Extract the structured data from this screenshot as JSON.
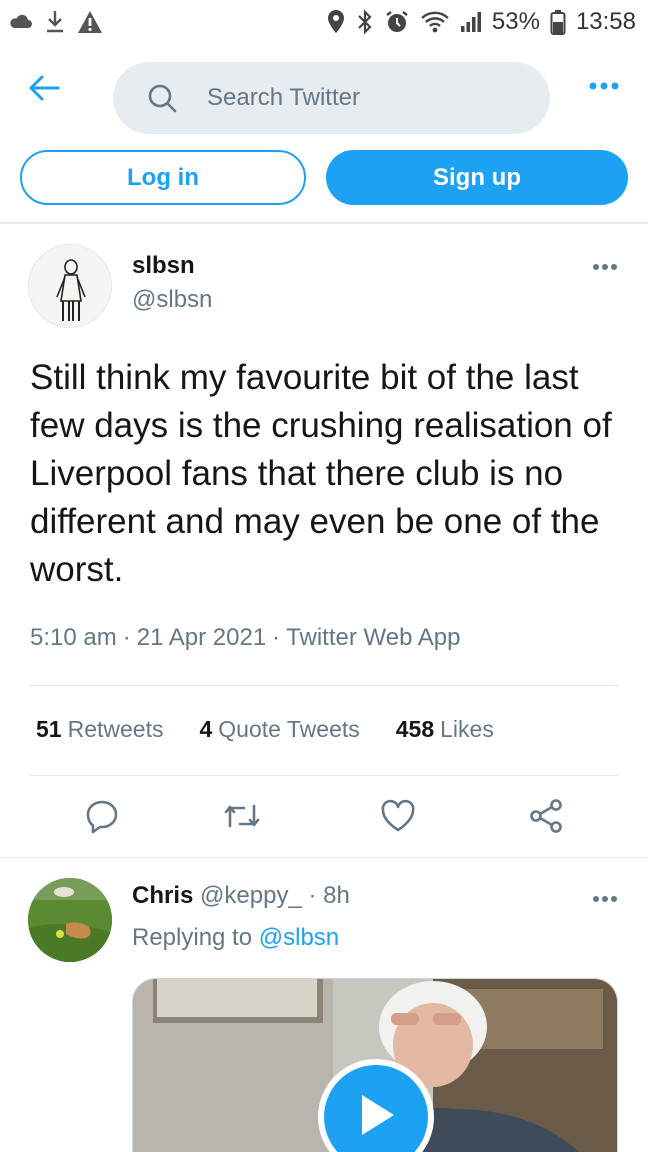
{
  "status_bar": {
    "battery": "53%",
    "time": "13:58"
  },
  "nav": {
    "back_icon": "arrow-left-icon",
    "search_placeholder": "Search Twitter",
    "more_icon": "more-dots-icon"
  },
  "auth": {
    "login_label": "Log in",
    "signup_label": "Sign up"
  },
  "tweet": {
    "author_name": "slbsn",
    "author_handle": "@slbsn",
    "text": "Still think my favourite bit of the last few days is the crushing realisation of Liverpool fans that there club is no different and may even be one of the worst.",
    "time": "5:10 am",
    "date": "21 Apr 2021",
    "source": "Twitter Web App",
    "retweets_count": "51",
    "retweets_label": "Retweets",
    "quotes_count": "4",
    "quotes_label": "Quote Tweets",
    "likes_count": "458",
    "likes_label": "Likes"
  },
  "reply": {
    "name": "Chris",
    "handle": "@keppy_",
    "time": "8h",
    "replying_prefix": "Replying to",
    "replying_to": "@slbsn"
  },
  "colors": {
    "accent": "#1da1f2",
    "muted": "#657786",
    "text": "#14171a",
    "border": "#e1e8ed"
  }
}
